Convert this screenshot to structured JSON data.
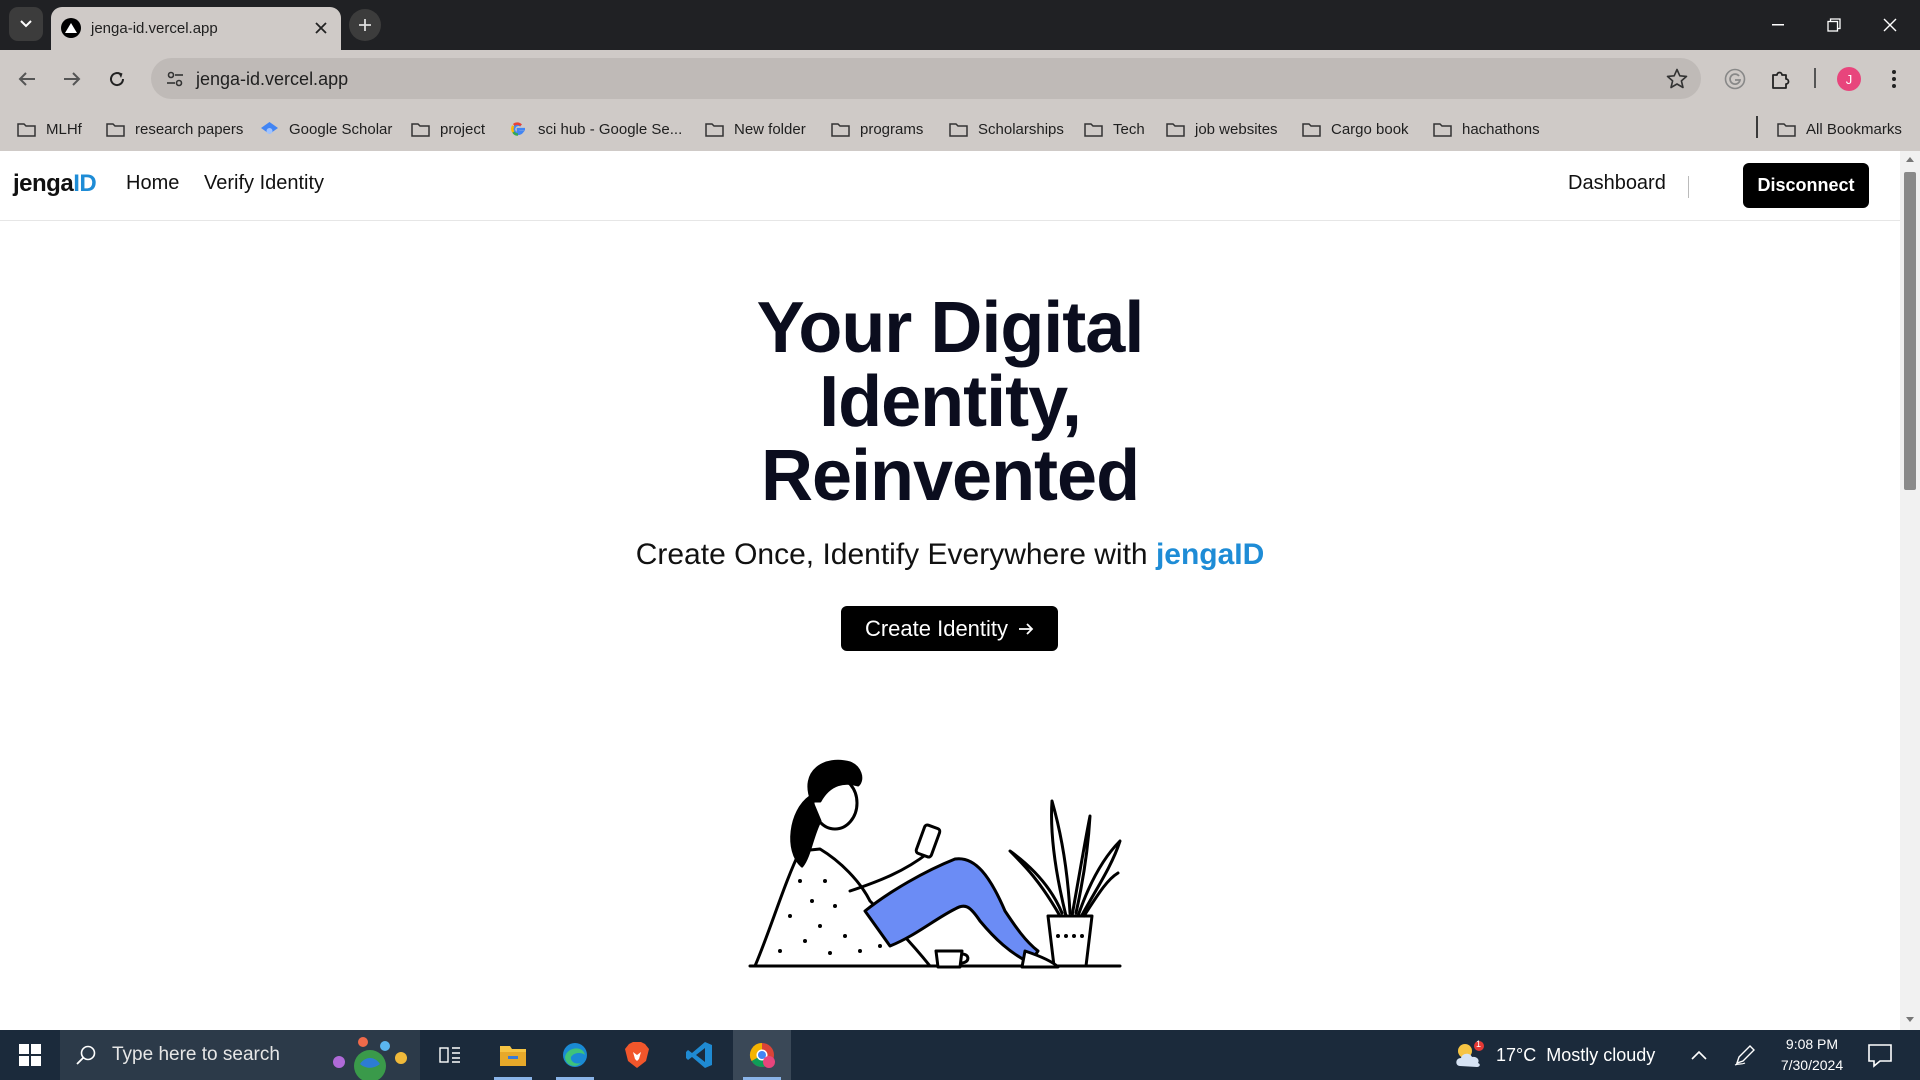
{
  "browser": {
    "tab_title": "jenga-id.vercel.app",
    "url": "jenga-id.vercel.app",
    "profile_initial": "J",
    "bookmarks": [
      {
        "label": "MLHf",
        "icon": "folder-icon"
      },
      {
        "label": "research papers",
        "icon": "folder-icon"
      },
      {
        "label": "Google Scholar",
        "icon": "scholar-icon"
      },
      {
        "label": "project",
        "icon": "folder-icon"
      },
      {
        "label": "sci hub - Google Se...",
        "icon": "google-icon"
      },
      {
        "label": "New folder",
        "icon": "folder-icon"
      },
      {
        "label": "programs",
        "icon": "folder-icon"
      },
      {
        "label": "Scholarships",
        "icon": "folder-icon"
      },
      {
        "label": "Tech",
        "icon": "folder-icon"
      },
      {
        "label": "job websites",
        "icon": "folder-icon"
      },
      {
        "label": "Cargo book",
        "icon": "folder-icon"
      },
      {
        "label": "hachathons",
        "icon": "folder-icon"
      }
    ],
    "all_bookmarks": "All Bookmarks"
  },
  "site": {
    "logo_main": "jenga",
    "logo_accent": "ID",
    "nav": {
      "home": "Home",
      "verify": "Verify Identity",
      "dashboard": "Dashboard",
      "disconnect": "Disconnect"
    },
    "hero": {
      "title_line1": "Your Digital",
      "title_line2": "Identity,",
      "title_line3": "Reinvented",
      "subtitle": "Create Once, Identify Everywhere with",
      "brand": "jengaID",
      "cta": "Create Identity"
    },
    "colors": {
      "accent": "#1e8cd6",
      "illustration_accent": "#6b8cf5",
      "button": "#000000"
    }
  },
  "taskbar": {
    "search_placeholder": "Type here to search",
    "weather_temp": "17°C",
    "weather_desc": "Mostly cloudy",
    "weather_badge": "1",
    "time": "9:08 PM",
    "date": "7/30/2024"
  }
}
